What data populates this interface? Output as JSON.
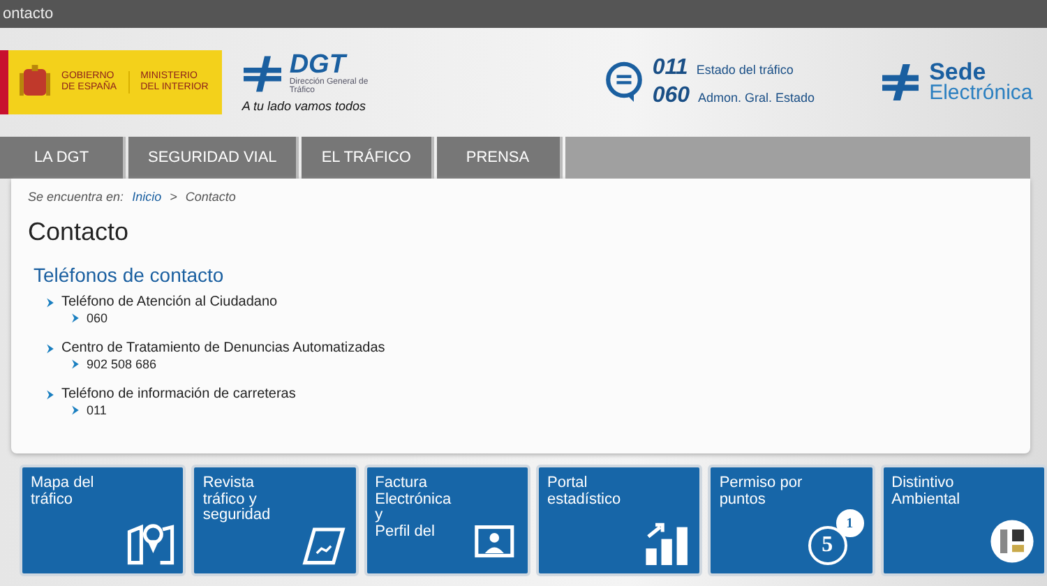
{
  "window": {
    "title": "ontacto"
  },
  "header": {
    "gov_line1": "GOBIERNO",
    "gov_line2": "DE ESPAÑA",
    "ministry_line1": "MINISTERIO",
    "ministry_line2": "DEL INTERIOR",
    "logo": "DGT",
    "logo_sub": "Dirección General de Tráfico",
    "slogan": "A tu lado vamos todos",
    "phones": [
      {
        "number": "011",
        "label": "Estado del tráfico"
      },
      {
        "number": "060",
        "label": "Admon. Gral. Estado"
      }
    ],
    "sede_line1": "Sede",
    "sede_line2": "Electrónica"
  },
  "tabs": [
    {
      "label": "LA DGT"
    },
    {
      "label": "SEGURIDAD VIAL"
    },
    {
      "label": "EL TRÁFICO"
    },
    {
      "label": "PRENSA"
    }
  ],
  "breadcrumb": {
    "prefix": "Se encuentra en:",
    "items": [
      "Inicio",
      "Contacto"
    ],
    "separator": ">"
  },
  "page_title": "Contacto",
  "section_title": "Teléfonos de contacto",
  "contacts": [
    {
      "name": "Teléfono de Atención al Ciudadano",
      "number": "060"
    },
    {
      "name": "Centro de Tratamiento de Denuncias Automatizadas",
      "number": "902 508 686"
    },
    {
      "name": "Teléfono de información de carreteras",
      "number": "011"
    }
  ],
  "tiles": [
    {
      "kind": "map",
      "lines": [
        "Mapa del",
        "tráfico"
      ]
    },
    {
      "kind": "magazine",
      "lines": [
        "Revista",
        "tráfico y",
        "seguridad"
      ]
    },
    {
      "kind": "invoice",
      "lines": [
        "Factura",
        "Electrónica",
        "y",
        "Perfil del"
      ]
    },
    {
      "kind": "stats",
      "lines": [
        "Portal",
        "estadístico"
      ]
    },
    {
      "kind": "points",
      "lines": [
        "Permiso por",
        "puntos"
      ],
      "badges": [
        "5",
        "1"
      ]
    },
    {
      "kind": "eco",
      "lines": [
        "Distintivo",
        "Ambiental"
      ]
    }
  ]
}
